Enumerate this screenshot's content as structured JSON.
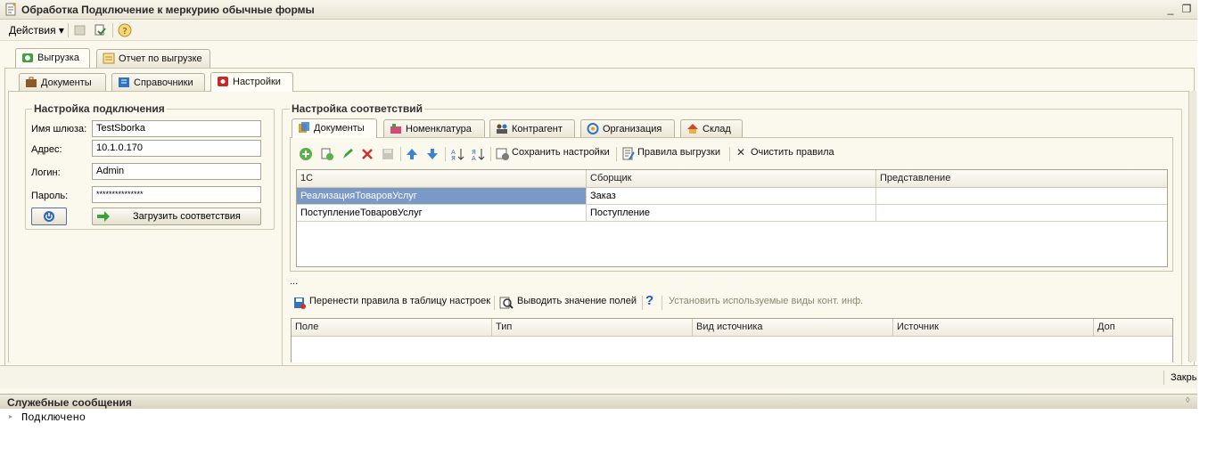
{
  "window": {
    "title": "Обработка  Подключение к меркурию обычные формы"
  },
  "menubar": {
    "actions_label": "Действия"
  },
  "main_tabs": [
    {
      "label": "Выгрузка"
    },
    {
      "label": "Отчет по выгрузке"
    }
  ],
  "sub_tabs": [
    {
      "label": "Документы"
    },
    {
      "label": "Справочники"
    },
    {
      "label": "Настройки"
    }
  ],
  "connection": {
    "title": "Настройка подключения",
    "gateway_label": "Имя шлюза:",
    "gateway_value": "TestSborka",
    "address_label": "Адрес:",
    "address_value": "10.1.0.170",
    "login_label": "Логин:",
    "login_value": "Admin",
    "password_label": "Пароль:",
    "password_value": "***************",
    "load_button": "Загрузить соответствия"
  },
  "mapping": {
    "title": "Настройка соответствий",
    "tabs": [
      {
        "label": "Документы"
      },
      {
        "label": "Номенклатура"
      },
      {
        "label": "Контрагент"
      },
      {
        "label": "Организация"
      },
      {
        "label": "Склад"
      }
    ],
    "toolbar": {
      "save_settings": "Сохранить настройки",
      "export_rules": "Правила выгрузки",
      "clear_rules": "Очистить правила"
    },
    "columns": [
      "1С",
      "Сборщик",
      "Представление"
    ],
    "rows": [
      [
        "РеализацияТоваровУслуг",
        "Заказ",
        ""
      ],
      [
        "ПоступлениеТоваровУслуг",
        "Поступление",
        ""
      ]
    ],
    "ellipsis": "...",
    "lower_toolbar": {
      "move_rules": "Перенести правила в таблицу настроек",
      "show_fields": "Выводить значение полей",
      "set_contact_types": "Установить используемые виды конт. инф."
    },
    "lower_columns": [
      "Поле",
      "Тип",
      "Вид источника",
      "Источник",
      "Доп"
    ]
  },
  "statusbar": {
    "close_label": "Закрыть"
  },
  "messages": {
    "title": "Служебные сообщения",
    "lines": [
      "Подключено"
    ]
  }
}
